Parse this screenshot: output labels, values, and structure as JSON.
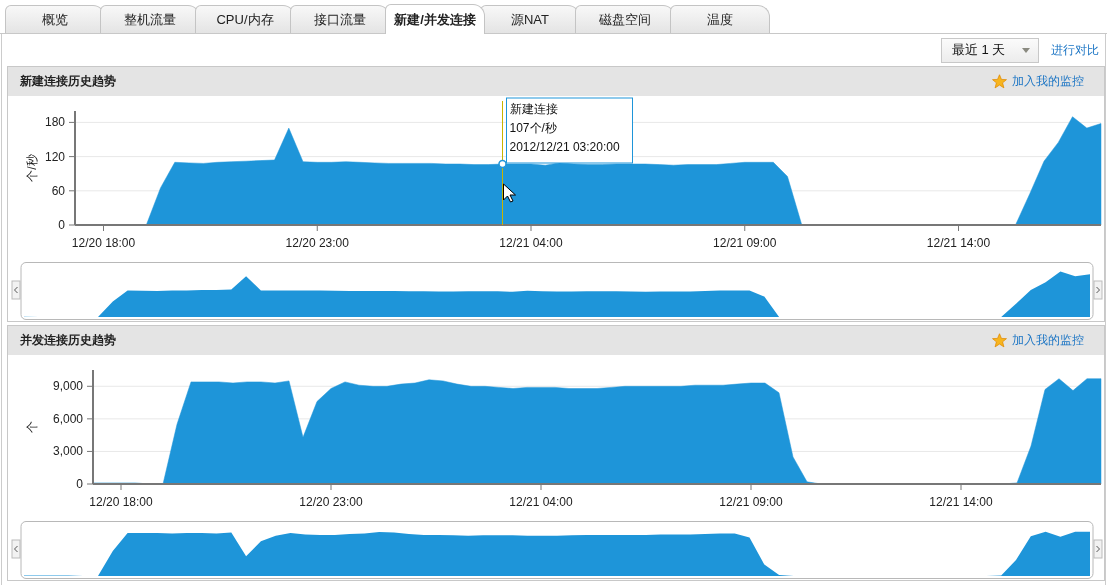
{
  "tabs": [
    {
      "label": "概览",
      "selected": false
    },
    {
      "label": "整机流量",
      "selected": false
    },
    {
      "label": "CPU/内存",
      "selected": false
    },
    {
      "label": "接口流量",
      "selected": false
    },
    {
      "label": "新建/并发连接",
      "selected": true
    },
    {
      "label": "源NAT",
      "selected": false
    },
    {
      "label": "磁盘空间",
      "selected": false
    },
    {
      "label": "温度",
      "selected": false
    }
  ],
  "toolbar": {
    "range": {
      "value": "最近 1 天"
    },
    "compare_link": "进行对比"
  },
  "panels": [
    {
      "title": "新建连接历史趋势",
      "watch_link": "加入我的监控",
      "chart_data": {
        "type": "area",
        "ylabel": "个/秒",
        "categories": [
          null,
          null,
          "12/20 18:00",
          null,
          null,
          null,
          null,
          null,
          null,
          null,
          null,
          null,
          null,
          null,
          null,
          null,
          null,
          "12/20 23:00",
          null,
          null,
          null,
          null,
          null,
          null,
          null,
          null,
          null,
          null,
          null,
          null,
          null,
          null,
          "12/21 04:00",
          null,
          null,
          null,
          null,
          null,
          null,
          null,
          null,
          null,
          null,
          null,
          null,
          null,
          null,
          "12/21 09:00",
          null,
          null,
          null,
          null,
          null,
          null,
          null,
          null,
          null,
          null,
          null,
          null,
          null,
          null,
          "12/21 14:00",
          null,
          null,
          null,
          null,
          null,
          null,
          null,
          null,
          null,
          null
        ],
        "series": [
          {
            "name": "新建连接",
            "color": "#1e95d9",
            "values": [
              1,
              0,
              0,
              0,
              0,
              0,
              65,
              110,
              109,
              108,
              110,
              111,
              112,
              113,
              114,
              170,
              111,
              110,
              110,
              111,
              110,
              109,
              108,
              108,
              108,
              108,
              107,
              107,
              106,
              106,
              107,
              107,
              107,
              105,
              109,
              107,
              106,
              106,
              107,
              107,
              107,
              106,
              105,
              106,
              106,
              106,
              108,
              110,
              110,
              110,
              85,
              0,
              0,
              0,
              0,
              0,
              0,
              0,
              0,
              0,
              0,
              0,
              0,
              0,
              0,
              0,
              0,
              55,
              112,
              145,
              190,
              170,
              178
            ]
          }
        ],
        "ylim": [
          0,
          200
        ],
        "yticks": [
          0,
          60,
          120,
          180
        ],
        "grid": true,
        "annotations": [
          {
            "y": 107,
            "text": "107个/秒\n2012/12/21 03:20:00"
          }
        ]
      }
    },
    {
      "title": "并发连接历史趋势",
      "watch_link": "加入我的监控",
      "chart_data": {
        "type": "area",
        "ylabel": "个",
        "categories": [
          null,
          null,
          "12/20 18:00",
          null,
          null,
          null,
          null,
          null,
          null,
          null,
          null,
          null,
          null,
          null,
          null,
          null,
          null,
          "12/20 23:00",
          null,
          null,
          null,
          null,
          null,
          null,
          null,
          null,
          null,
          null,
          null,
          null,
          null,
          null,
          "12/21 04:00",
          null,
          null,
          null,
          null,
          null,
          null,
          null,
          null,
          null,
          null,
          null,
          null,
          null,
          null,
          "12/21 09:00",
          null,
          null,
          null,
          null,
          null,
          null,
          null,
          null,
          null,
          null,
          null,
          null,
          null,
          null,
          "12/21 14:00",
          null,
          null,
          null,
          null,
          null,
          null,
          null,
          null,
          null,
          null
        ],
        "series": [
          {
            "color": "#1e95d9",
            "values": [
              100,
              100,
              100,
              100,
              0,
              0,
              5500,
              9400,
              9400,
              9400,
              9300,
              9400,
              9400,
              9300,
              9500,
              4300,
              7600,
              8800,
              9400,
              9100,
              9000,
              9000,
              9200,
              9300,
              9600,
              9500,
              9200,
              9000,
              9000,
              8900,
              8800,
              8900,
              8900,
              8900,
              8800,
              8800,
              8800,
              8900,
              9000,
              9000,
              9000,
              9000,
              9000,
              9100,
              9100,
              9100,
              9200,
              9300,
              9300,
              8400,
              2500,
              200,
              0,
              0,
              0,
              0,
              0,
              0,
              0,
              0,
              0,
              0,
              0,
              0,
              0,
              0,
              100,
              3500,
              8700,
              9700,
              8600,
              9700,
              9700
            ]
          }
        ],
        "ylim": [
          0,
          10500
        ],
        "grid": true,
        "yticks": [
          {
            "value": 0,
            "label": "0"
          },
          {
            "value": 3000,
            "label": "3,000"
          },
          {
            "value": 6000,
            "label": "6,000"
          },
          {
            "value": 9000,
            "label": "9,000"
          }
        ]
      }
    }
  ]
}
